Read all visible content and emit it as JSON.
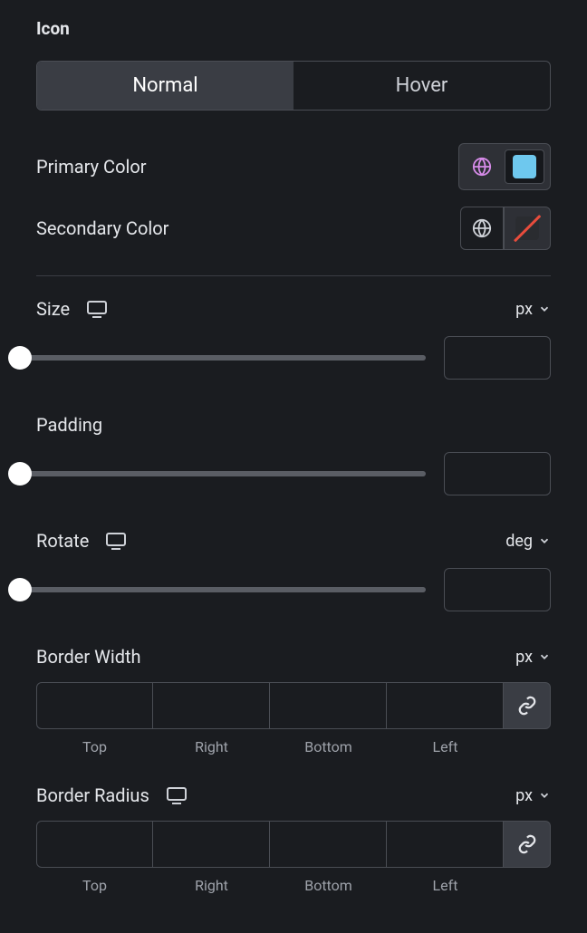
{
  "section": {
    "title": "Icon"
  },
  "tabs": {
    "normal": "Normal",
    "hover": "Hover"
  },
  "primaryColor": {
    "label": "Primary Color",
    "swatch": "#6ec8ee"
  },
  "secondaryColor": {
    "label": "Secondary Color"
  },
  "size": {
    "label": "Size",
    "unit": "px",
    "value": ""
  },
  "padding": {
    "label": "Padding",
    "value": ""
  },
  "rotate": {
    "label": "Rotate",
    "unit": "deg",
    "value": ""
  },
  "borderWidth": {
    "label": "Border Width",
    "unit": "px",
    "sides": {
      "top": "Top",
      "right": "Right",
      "bottom": "Bottom",
      "left": "Left"
    },
    "values": {
      "top": "",
      "right": "",
      "bottom": "",
      "left": ""
    }
  },
  "borderRadius": {
    "label": "Border Radius",
    "unit": "px",
    "sides": {
      "top": "Top",
      "right": "Right",
      "bottom": "Bottom",
      "left": "Left"
    },
    "values": {
      "top": "",
      "right": "",
      "bottom": "",
      "left": ""
    }
  }
}
